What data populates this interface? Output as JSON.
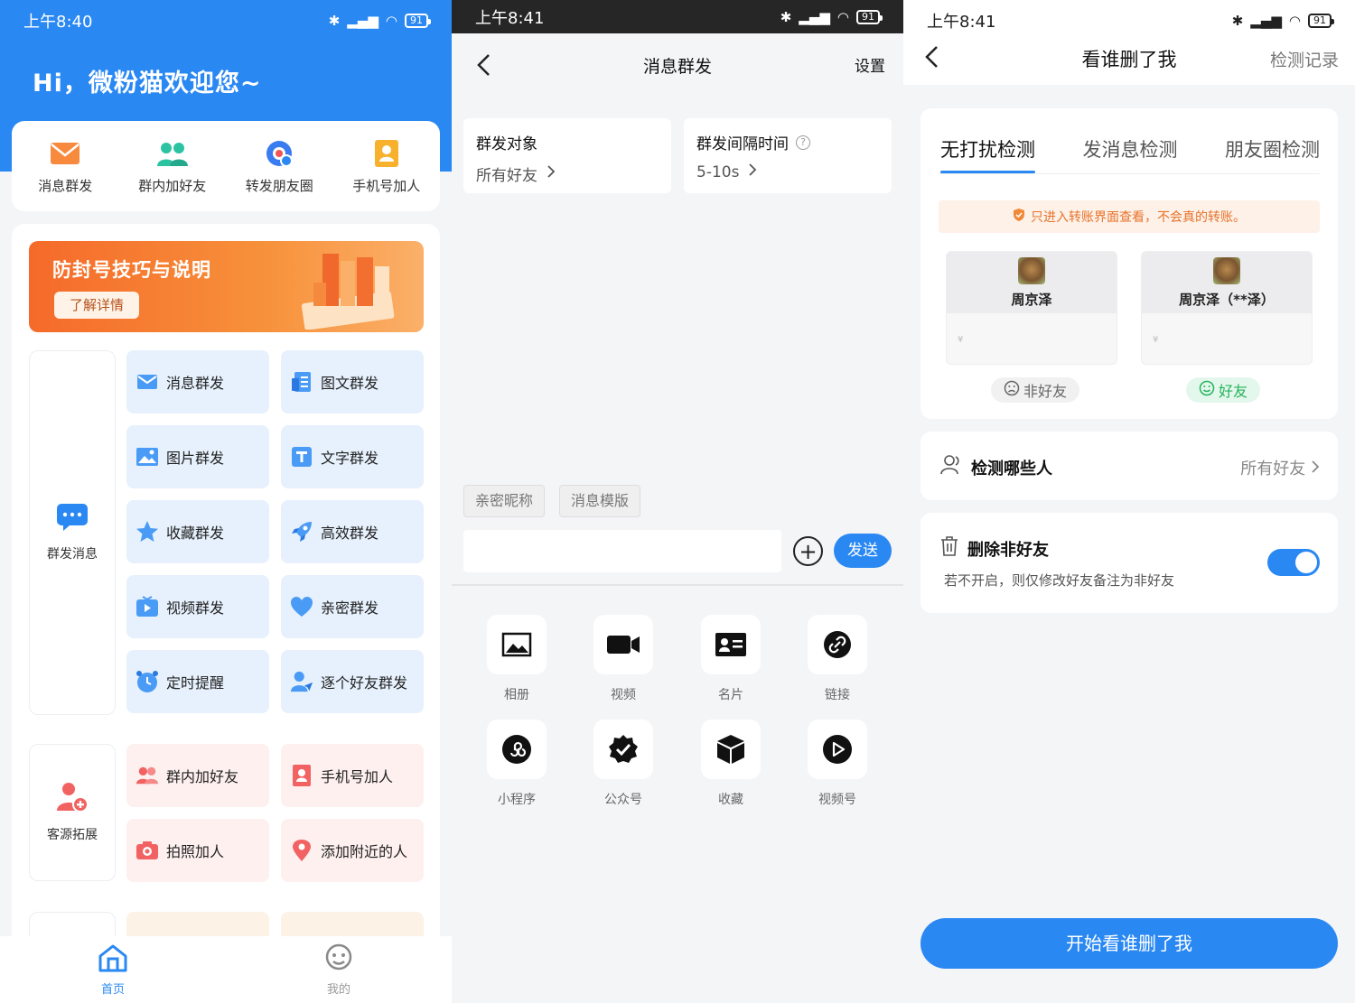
{
  "colors": {
    "primary": "#2a88f3",
    "orange": "#f56a2a",
    "green": "#24b35b"
  },
  "statusbars": [
    {
      "time": "上午8:40",
      "battery": "91"
    },
    {
      "time": "上午8:41",
      "battery": "91"
    },
    {
      "time": "上午8:41",
      "battery": "91"
    }
  ],
  "home": {
    "greeting": "Hi，微粉猫欢迎您~",
    "quick": [
      {
        "label": "消息群发",
        "icon": "envelope-icon"
      },
      {
        "label": "群内加好友",
        "icon": "group-users-icon"
      },
      {
        "label": "转发朋友圈",
        "icon": "moments-camera-icon"
      },
      {
        "label": "手机号加人",
        "icon": "phonebook-icon"
      }
    ],
    "banner": {
      "title": "防封号技巧与说明",
      "button": "了解详情"
    },
    "group1": {
      "label": "群发消息",
      "tiles": [
        "消息群发",
        "图文群发",
        "图片群发",
        "文字群发",
        "收藏群发",
        "高效群发",
        "视频群发",
        "亲密群发",
        "定时提醒",
        "逐个好友群发"
      ]
    },
    "group2": {
      "label": "客源拓展",
      "tiles": [
        "群内加好友",
        "手机号加人",
        "拍照加人",
        "添加附近的人"
      ]
    },
    "tabs": [
      {
        "label": "首页",
        "icon": "home-icon"
      },
      {
        "label": "我的",
        "icon": "profile-face-icon"
      }
    ]
  },
  "broadcast": {
    "title": "消息群发",
    "settings": "设置",
    "target_label": "群发对象",
    "target_value": "所有好友",
    "interval_label": "群发间隔时间",
    "interval_value": "5-10s",
    "chips": [
      "亲密昵称",
      "消息模版"
    ],
    "input_placeholder": "",
    "send": "发送",
    "tools": [
      {
        "label": "相册",
        "icon": "album-icon"
      },
      {
        "label": "视频",
        "icon": "video-camera-icon"
      },
      {
        "label": "名片",
        "icon": "card-icon"
      },
      {
        "label": "链接",
        "icon": "link-icon"
      },
      {
        "label": "小程序",
        "icon": "mini-program-icon"
      },
      {
        "label": "公众号",
        "icon": "official-account-icon"
      },
      {
        "label": "收藏",
        "icon": "cube-icon"
      },
      {
        "label": "视频号",
        "icon": "play-icon"
      }
    ]
  },
  "detect": {
    "title": "看谁删了我",
    "records": "检测记录",
    "tabs": [
      "无打扰检测",
      "发消息检测",
      "朋友圈检测"
    ],
    "notice": "只进入转账界面查看，不会真的转账。",
    "contacts": [
      {
        "name": "周京泽",
        "status": "非好友"
      },
      {
        "name": "周京泽（**泽）",
        "status": "好友"
      }
    ],
    "who_label": "检测哪些人",
    "who_value": "所有好友",
    "delete_label": "删除非好友",
    "delete_sub": "若不开启，则仅修改好友备注为非好友",
    "delete_enabled": true,
    "start": "开始看谁删了我"
  }
}
